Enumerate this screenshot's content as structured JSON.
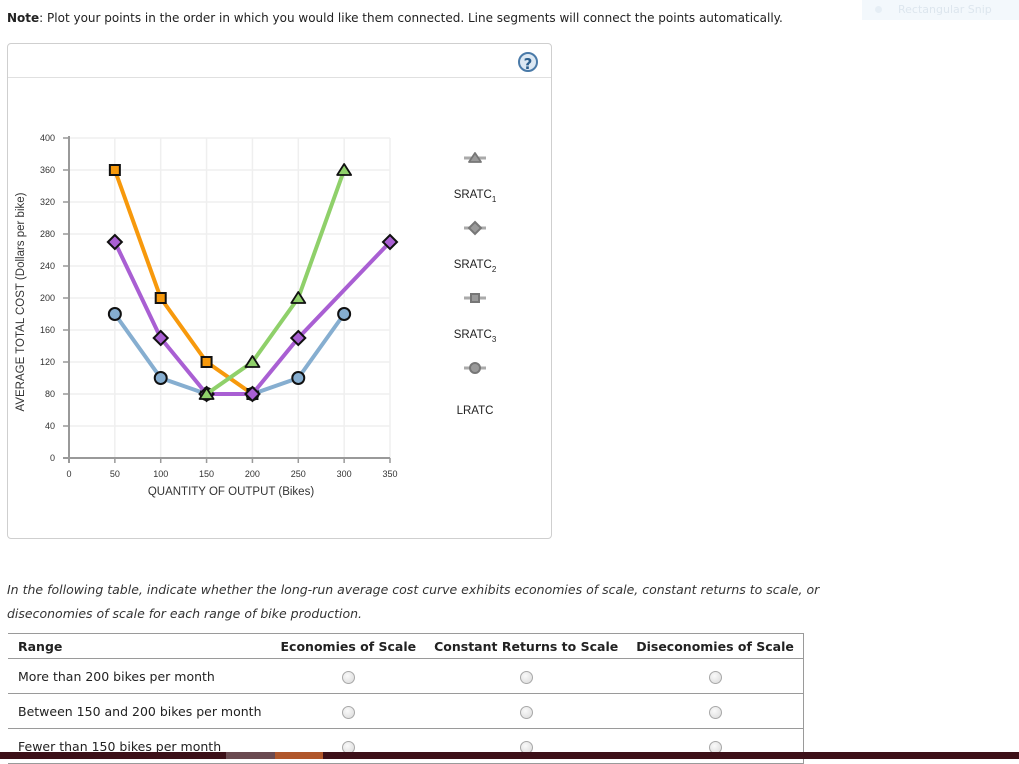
{
  "note": {
    "bold": "Note",
    "text": ": Plot your points in the order in which you would like them connected. Line segments will connect the points automatically."
  },
  "overlay": {
    "label": "Rectangular Snip"
  },
  "help_icon": "?",
  "chart_data": {
    "type": "line",
    "xlabel": "QUANTITY OF OUTPUT (Bikes)",
    "ylabel": "AVERAGE TOTAL COST (Dollars per bike)",
    "xlim": [
      0,
      350
    ],
    "ylim": [
      0,
      400
    ],
    "xticks": [
      0,
      50,
      100,
      150,
      200,
      250,
      300,
      350
    ],
    "yticks": [
      0,
      40,
      80,
      120,
      160,
      200,
      240,
      280,
      320,
      360,
      400
    ],
    "grid": true,
    "legend_position": "right",
    "series": [
      {
        "name": "SRATC",
        "sub": "1",
        "marker": "triangle",
        "color": "#8fd06a",
        "points": [
          [
            150,
            80
          ],
          [
            200,
            120
          ],
          [
            250,
            200
          ],
          [
            300,
            360
          ]
        ]
      },
      {
        "name": "SRATC",
        "sub": "2",
        "marker": "diamond",
        "color": "#a95fd3",
        "points": [
          [
            50,
            270
          ],
          [
            100,
            150
          ],
          [
            150,
            80
          ],
          [
            200,
            80
          ],
          [
            250,
            150
          ],
          [
            350,
            270
          ]
        ]
      },
      {
        "name": "SRATC",
        "sub": "3",
        "marker": "square",
        "color": "#f7990c",
        "points": [
          [
            50,
            360
          ],
          [
            100,
            200
          ],
          [
            150,
            120
          ],
          [
            200,
            80
          ]
        ]
      },
      {
        "name": "LRATC",
        "sub": "",
        "marker": "circle",
        "color": "#86aed0",
        "points": [
          [
            50,
            180
          ],
          [
            100,
            100
          ],
          [
            150,
            80
          ],
          [
            200,
            80
          ],
          [
            250,
            100
          ],
          [
            300,
            180
          ]
        ]
      }
    ]
  },
  "instructions": "In the following table, indicate whether the long-run average cost curve exhibits economies of scale, constant returns to scale, or diseconomies of scale for each range of bike production.",
  "table": {
    "headers": [
      "Range",
      "Economies of Scale",
      "Constant Returns to Scale",
      "Diseconomies of Scale"
    ],
    "rows": [
      {
        "range": "More than 200 bikes per month"
      },
      {
        "range": "Between 150 and 200 bikes per month"
      },
      {
        "range": "Fewer than 150 bikes per month"
      }
    ]
  }
}
